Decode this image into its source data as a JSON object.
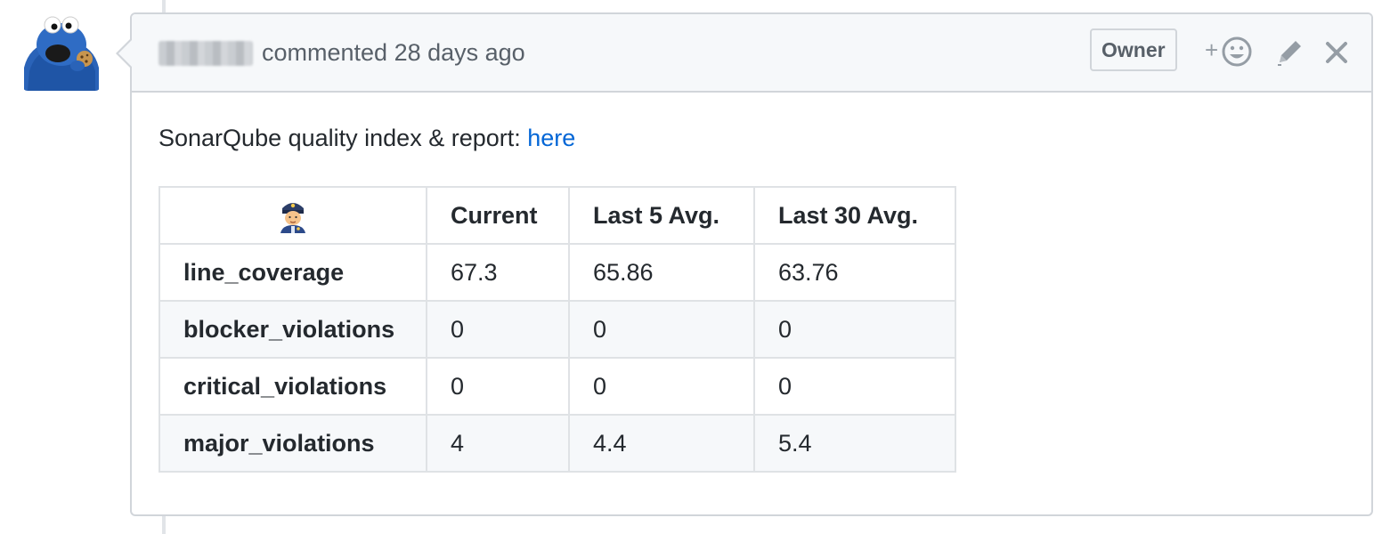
{
  "comment": {
    "author_redacted": true,
    "meta": "commented 28 days ago",
    "badge": "Owner",
    "actions": {
      "react_icon": "add-reaction-icon",
      "edit_icon": "pencil-icon",
      "close_icon": "close-icon"
    },
    "body": {
      "text": "SonarQube quality index & report: ",
      "link_label": "here"
    }
  },
  "table": {
    "header_icon": "police-officer-emoji",
    "headers": [
      "Current",
      "Last 5 Avg.",
      "Last 30 Avg."
    ],
    "rows": [
      {
        "label": "line_coverage",
        "values": [
          "67.3",
          "65.86",
          "63.76"
        ]
      },
      {
        "label": "blocker_violations",
        "values": [
          "0",
          "0",
          "0"
        ]
      },
      {
        "label": "critical_violations",
        "values": [
          "0",
          "0",
          "0"
        ]
      },
      {
        "label": "major_violations",
        "values": [
          "4",
          "4.4",
          "5.4"
        ]
      }
    ]
  },
  "colors": {
    "link": "#0366d6",
    "header_bg": "#f6f8fa",
    "border": "#d1d5da",
    "avatar_blue": "#2a63b8"
  }
}
